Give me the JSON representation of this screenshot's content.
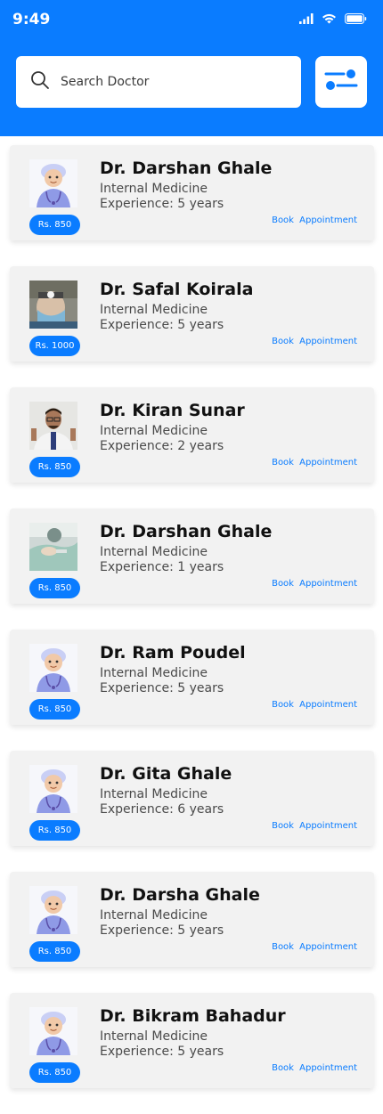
{
  "status_bar": {
    "time": "9:49",
    "icons": [
      "signal-icon",
      "wifi-icon",
      "battery-icon"
    ]
  },
  "search": {
    "placeholder": "Search Doctor",
    "value": "",
    "icon": "search-icon"
  },
  "filter": {
    "icon": "filter-sliders-icon"
  },
  "colors": {
    "accent": "#0a7cff",
    "card_bg": "#f2f2f2",
    "link": "#0a7cff"
  },
  "book_label": "Book  Appointment",
  "doctors": [
    {
      "name": "Dr. Darshan Ghale",
      "specialty": "Internal Medicine",
      "experience": "Experience: 5 years",
      "fee": "Rs. 850",
      "photo": "child-doctor"
    },
    {
      "name": "Dr. Safal Koirala",
      "specialty": "Internal Medicine",
      "experience": "Experience: 5 years",
      "fee": "Rs. 1000",
      "photo": "surgeon-headlamp"
    },
    {
      "name": "Dr. Kiran Sunar",
      "specialty": "Internal Medicine",
      "experience": "Experience: 2 years",
      "fee": "Rs. 850",
      "photo": "doctor-with-glasses"
    },
    {
      "name": "Dr. Darshan Ghale",
      "specialty": "Internal Medicine",
      "experience": "Experience: 1 years",
      "fee": "Rs. 850",
      "photo": "dentist"
    },
    {
      "name": "Dr. Ram Poudel",
      "specialty": "Internal Medicine",
      "experience": "Experience: 5 years",
      "fee": "Rs. 850",
      "photo": "child-doctor"
    },
    {
      "name": "Dr. Gita Ghale",
      "specialty": "Internal Medicine",
      "experience": "Experience: 6 years",
      "fee": "Rs. 850",
      "photo": "child-doctor"
    },
    {
      "name": "Dr. Darsha Ghale",
      "specialty": "Internal Medicine",
      "experience": "Experience: 5 years",
      "fee": "Rs. 850",
      "photo": "child-doctor"
    },
    {
      "name": "Dr. Bikram Bahadur",
      "specialty": "Internal Medicine",
      "experience": "Experience: 5 years",
      "fee": "Rs. 850",
      "photo": "child-doctor"
    }
  ]
}
